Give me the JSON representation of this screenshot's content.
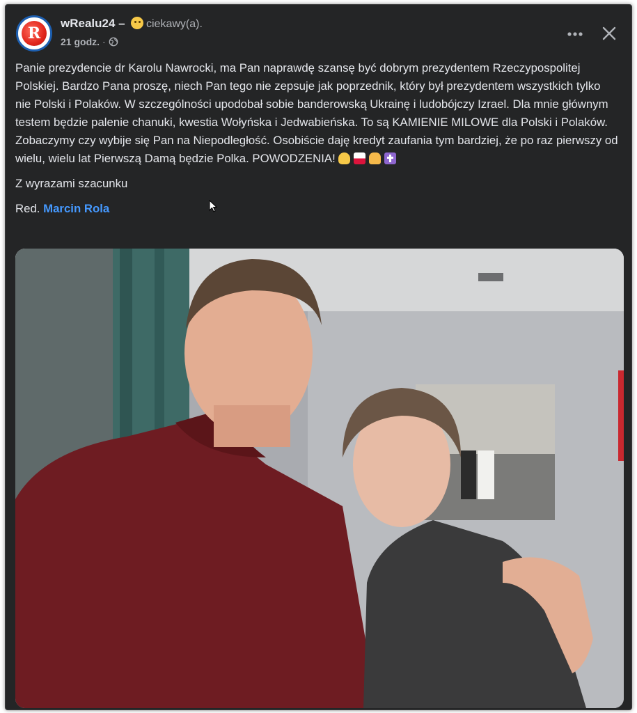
{
  "post": {
    "page_name": "wRealu24",
    "separator": "–",
    "feeling": "ciekawy(a).",
    "time": "21 godz.",
    "dot": "·",
    "paragraphs": [
      "Panie prezydencie dr Karolu Nawrocki, ma Pan naprawdę szansę być dobrym prezydentem Rzeczypospolitej Polskiej. Bardzo Pana proszę, niech Pan tego nie zepsuje jak poprzednik, który był prezydentem wszystkich tylko nie Polski i Polaków. W szczególności upodobał sobie banderowską Ukrainę i ludobójczy Izrael. Dla mnie głównym testem będzie palenie chanuki, kwestia Wołyńska i Jedwabieńska. To są KAMIENIE MILOWE dla Polski i Polaków. Zobaczymy czy wybije się Pan na Niepodległość. Osobiście daję kredyt zaufania tym bardziej, że po raz pierwszy od wielu, wielu lat Pierwszą Damą będzie Polka. POWODZENIA!"
    ],
    "closing": "Z wyrazami szacunku",
    "signature_prefix": "Red.",
    "signature_author": "Marcin Rola",
    "emoji_icons": [
      "victory-hand-icon",
      "poland-flag-icon",
      "praying-hands-icon",
      "cross-icon"
    ]
  },
  "photo": {
    "description_icon": "post-photo"
  },
  "colors": {
    "background": "#242526",
    "text": "#e4e6eb",
    "secondary_text": "#b0b3b8",
    "link": "#4599ff"
  }
}
